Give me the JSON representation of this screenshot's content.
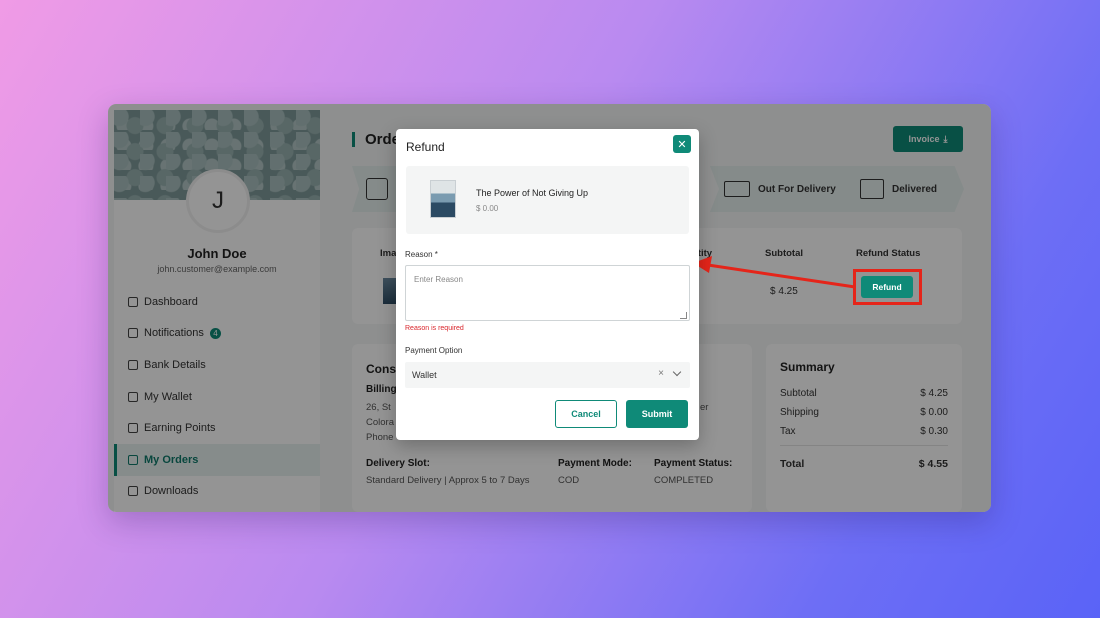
{
  "sidebar": {
    "avatar_initial": "J",
    "user_name": "John Doe",
    "user_email": "john.customer@example.com",
    "items": [
      {
        "label": "Dashboard",
        "icon": "home-icon"
      },
      {
        "label": "Notifications",
        "icon": "bell-icon",
        "badge": "4"
      },
      {
        "label": "Bank Details",
        "icon": "bank-icon"
      },
      {
        "label": "My Wallet",
        "icon": "wallet-icon"
      },
      {
        "label": "Earning Points",
        "icon": "coins-icon"
      },
      {
        "label": "My Orders",
        "icon": "document-icon",
        "active": true
      },
      {
        "label": "Downloads",
        "icon": "download-icon"
      }
    ]
  },
  "main": {
    "title": "Order",
    "invoice_label": "Invoice",
    "steps": [
      {
        "label": "Out For Delivery",
        "icon": "truck-icon"
      },
      {
        "label": "Delivered",
        "icon": "store-icon"
      }
    ],
    "table": {
      "headers": {
        "image": "Ima",
        "quantity": "ntity",
        "subtotal": "Subtotal",
        "refund_status": "Refund Status"
      },
      "row": {
        "subtotal": "$ 4.25",
        "refund_label": "Refund"
      }
    },
    "consignee": {
      "title": "Cons",
      "billing_label": "Billing",
      "address_lines": [
        "26, St",
        "Colora",
        "Phone"
      ],
      "extra": "er",
      "delivery_slot_label": "Delivery Slot:",
      "delivery_slot_value": "Standard Delivery | Approx 5 to 7 Days",
      "payment_mode_label": "Payment Mode:",
      "payment_mode_value": "COD",
      "payment_status_label": "Payment Status:",
      "payment_status_value": "COMPLETED"
    },
    "summary": {
      "title": "Summary",
      "rows": [
        {
          "label": "Subtotal",
          "value": "$ 4.25"
        },
        {
          "label": "Shipping",
          "value": "$ 0.00"
        },
        {
          "label": "Tax",
          "value": "$ 0.30"
        }
      ],
      "total_label": "Total",
      "total_value": "$ 4.55"
    }
  },
  "modal": {
    "title": "Refund",
    "close_icon": "close-icon",
    "product_name": "The Power of Not Giving Up",
    "product_price": "$ 0.00",
    "reason_label": "Reason *",
    "reason_placeholder": "Enter Reason",
    "reason_error": "Reason is required",
    "payment_label": "Payment Option",
    "payment_value": "Wallet",
    "cancel_label": "Cancel",
    "submit_label": "Submit"
  },
  "colors": {
    "accent": "#0f8a78",
    "annotation": "#e5251a",
    "error": "#d9262c"
  }
}
